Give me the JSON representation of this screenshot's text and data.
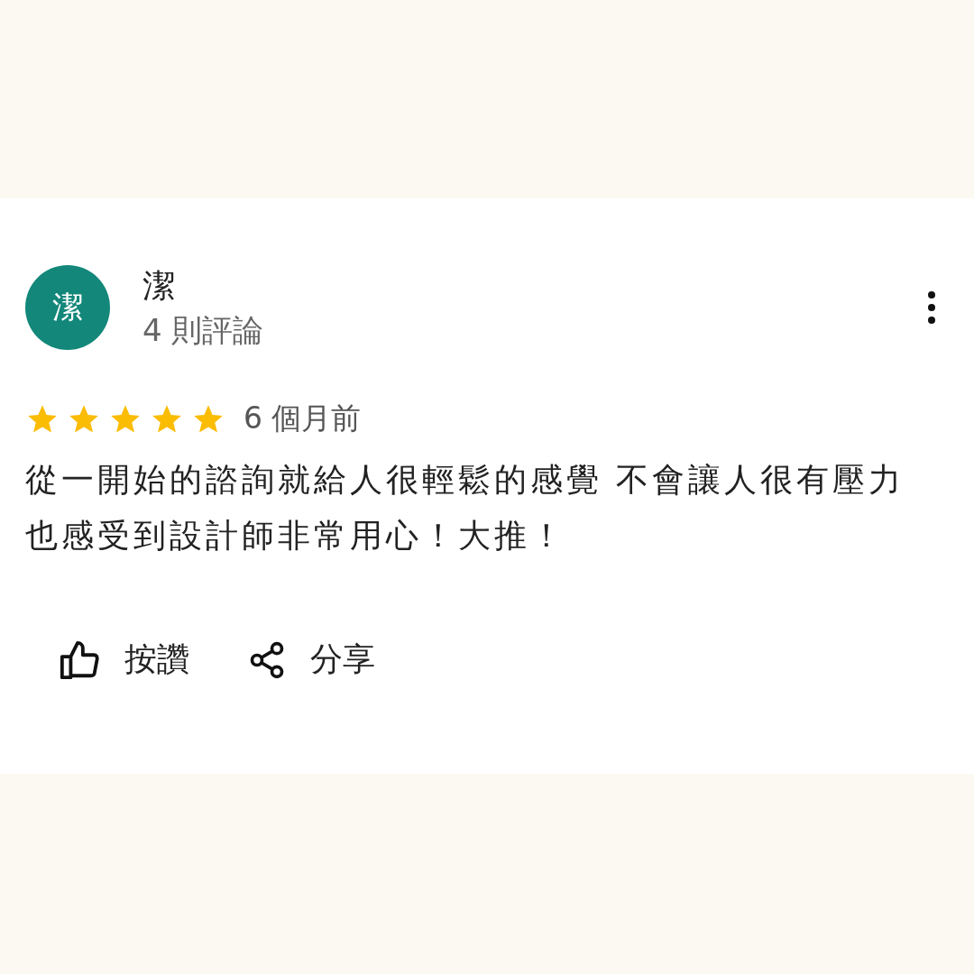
{
  "review": {
    "avatar_letter": "潔",
    "author": "潔",
    "review_count": "4 則評論",
    "stars": 5,
    "time": "6 個月前",
    "text": "從一開始的諮詢就給人很輕鬆的感覺 不會讓人很有壓力也感受到設計師非常用心！大推！"
  },
  "actions": [
    {
      "kind": "like",
      "label": "按讚"
    },
    {
      "kind": "share",
      "label": "分享"
    }
  ]
}
